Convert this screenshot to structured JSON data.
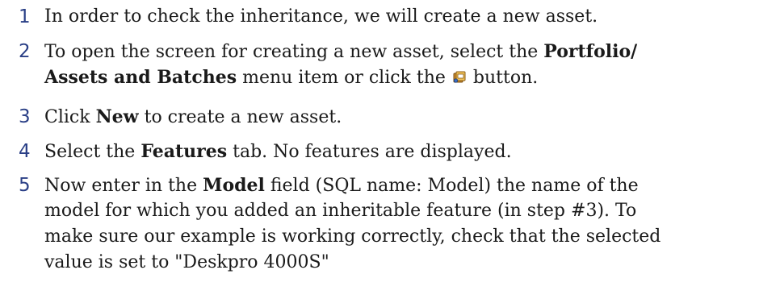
{
  "steps": [
    {
      "number": "1",
      "lines": [
        {
          "parts": [
            "In order to check the inheritance, we will create a new asset."
          ]
        }
      ]
    },
    {
      "number": "2",
      "lines": [
        {
          "parts": [
            "To open the screen for creating a new asset, select the ",
            "Portfolio/"
          ]
        },
        {
          "parts": [
            "Assets and Batches",
            " menu item or click the ",
            " button."
          ]
        }
      ]
    },
    {
      "number": "3",
      "lines": [
        {
          "parts": [
            "Click ",
            "New",
            " to create a new asset."
          ]
        }
      ]
    },
    {
      "number": "4",
      "lines": [
        {
          "parts": [
            "Select the ",
            "Features",
            " tab. No features are displayed."
          ]
        }
      ]
    },
    {
      "number": "5",
      "lines": [
        {
          "parts": [
            "Now enter in the ",
            "Model",
            " field (SQL name: Model) the name of the"
          ]
        },
        {
          "parts": [
            "model for which you added an inheritable feature (in step #3). To"
          ]
        },
        {
          "parts": [
            "make sure our example is working correctly, check that the selected"
          ]
        },
        {
          "parts": [
            "value is set to \"Deskpro 4000S\""
          ]
        }
      ]
    }
  ],
  "icons": {
    "assets_button_icon": "assets-batches-icon"
  }
}
